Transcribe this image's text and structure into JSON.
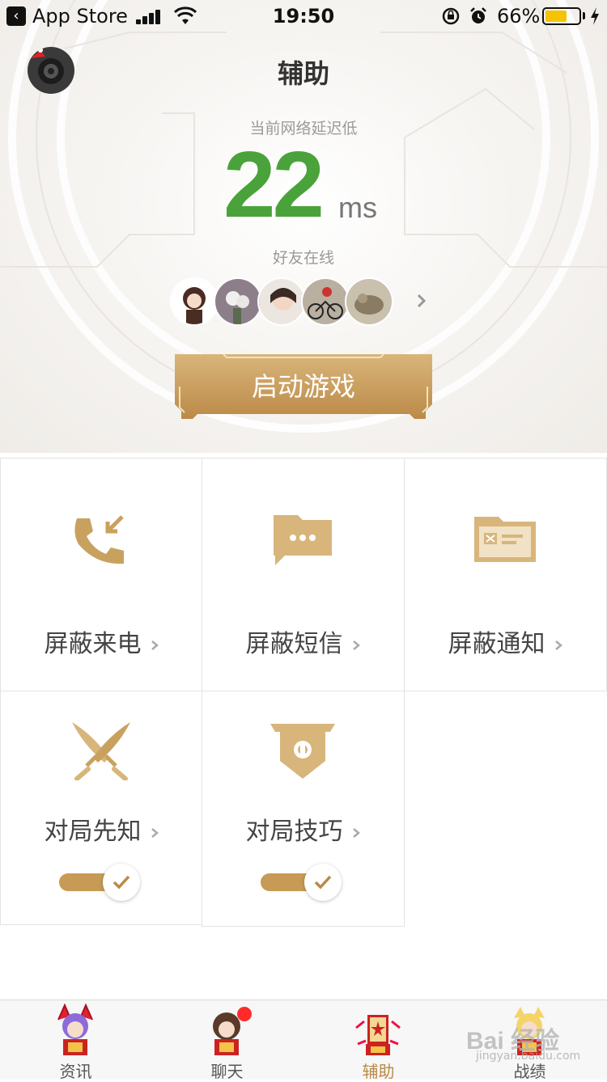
{
  "status_bar": {
    "back_app": "App Store",
    "time": "19:50",
    "battery_percent": "66%",
    "battery_level": 0.66
  },
  "header": {
    "title": "辅助",
    "latency_label": "当前网络延迟低",
    "latency_value": "22",
    "latency_unit": "ms",
    "friends_label": "好友在线",
    "launch_button": "启动游戏"
  },
  "colors": {
    "accent_gold": "#c79a55",
    "latency_green": "#4aa33a",
    "badge_red": "#ff2b2b"
  },
  "features": [
    {
      "label": "屏蔽来电",
      "icon": "incoming-call-icon"
    },
    {
      "label": "屏蔽短信",
      "icon": "message-icon"
    },
    {
      "label": "屏蔽通知",
      "icon": "notification-card-icon"
    },
    {
      "label": "对局先知",
      "icon": "crossed-swords-icon",
      "toggle_on": true
    },
    {
      "label": "对局技巧",
      "icon": "banner-icon",
      "toggle_on": true
    }
  ],
  "tabs": [
    {
      "label": "资讯",
      "icon": "news-hero-icon"
    },
    {
      "label": "聊天",
      "icon": "chat-hero-icon",
      "badge": true
    },
    {
      "label": "辅助",
      "icon": "assist-scroll-icon",
      "active": true
    },
    {
      "label": "战绩",
      "icon": "record-hero-icon"
    }
  ],
  "watermark": {
    "text": "Bai 经验",
    "sub": "jingyan.baidu.com"
  }
}
